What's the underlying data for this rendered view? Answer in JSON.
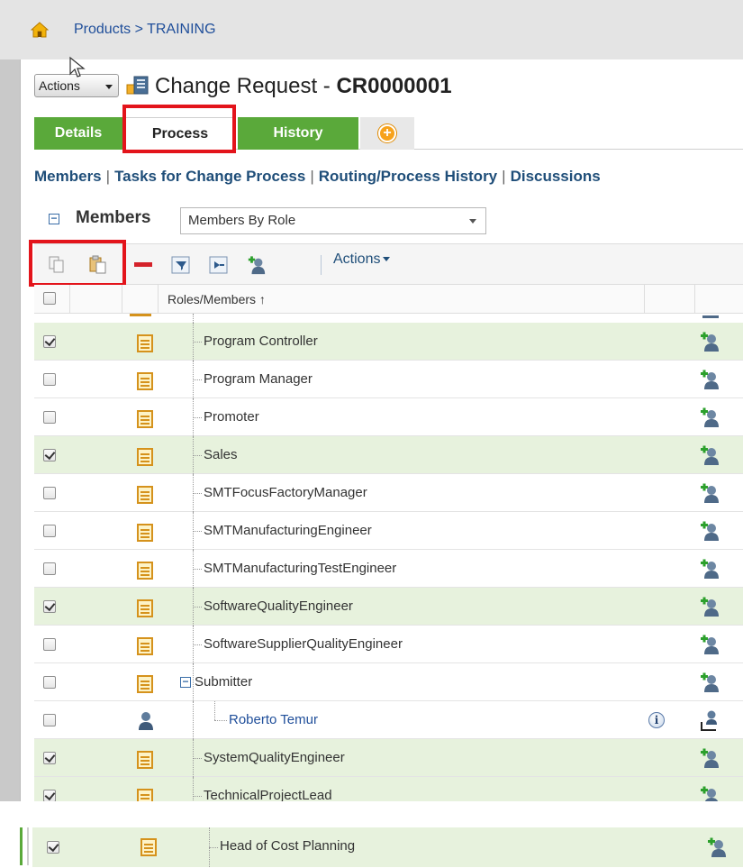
{
  "breadcrumb": "Products > TRAINING",
  "header": {
    "actions_label": "Actions",
    "title_prefix": "Change Request - ",
    "title_id": "CR0000001"
  },
  "tabs": [
    {
      "label": "Details"
    },
    {
      "label": "Process"
    },
    {
      "label": "History"
    }
  ],
  "subnav": [
    "Members",
    "Tasks for Change Process",
    "Routing/Process History",
    "Discussions"
  ],
  "members": {
    "title": "Members",
    "view_selected": "Members By Role"
  },
  "toolbar": {
    "actions_label": "Actions"
  },
  "table": {
    "column_header": "Roles/Members",
    "sort_indicator": "↑",
    "rows": [
      {
        "label": "Program Controller",
        "checked": true
      },
      {
        "label": "Program Manager",
        "checked": false
      },
      {
        "label": "Promoter",
        "checked": false
      },
      {
        "label": "Sales",
        "checked": true
      },
      {
        "label": "SMTFocusFactoryManager",
        "checked": false
      },
      {
        "label": "SMTManufacturingEngineer",
        "checked": false
      },
      {
        "label": "SMTManufacturingTestEngineer",
        "checked": false
      },
      {
        "label": "SoftwareQualityEngineer",
        "checked": true
      },
      {
        "label": "SoftwareSupplierQualityEngineer",
        "checked": false
      },
      {
        "label": "Submitter",
        "checked": false
      },
      {
        "label": "Roberto Temur",
        "checked": false
      },
      {
        "label": "SystemQualityEngineer",
        "checked": true
      },
      {
        "label": "TechnicalProjectLead",
        "checked": true
      }
    ]
  },
  "bottom_row": {
    "label": "Head of Cost Planning",
    "checked": true
  },
  "icons": {
    "home": "home-icon",
    "copy": "copy-icon",
    "paste": "paste-icon",
    "remove": "remove-icon",
    "add_user": "add-user-icon",
    "info": "info-icon"
  },
  "colors": {
    "tab_green": "#5aa93a",
    "highlight_red": "#e3141b",
    "selected_row": "#e7f2dd",
    "link_blue": "#1f4e9a"
  }
}
